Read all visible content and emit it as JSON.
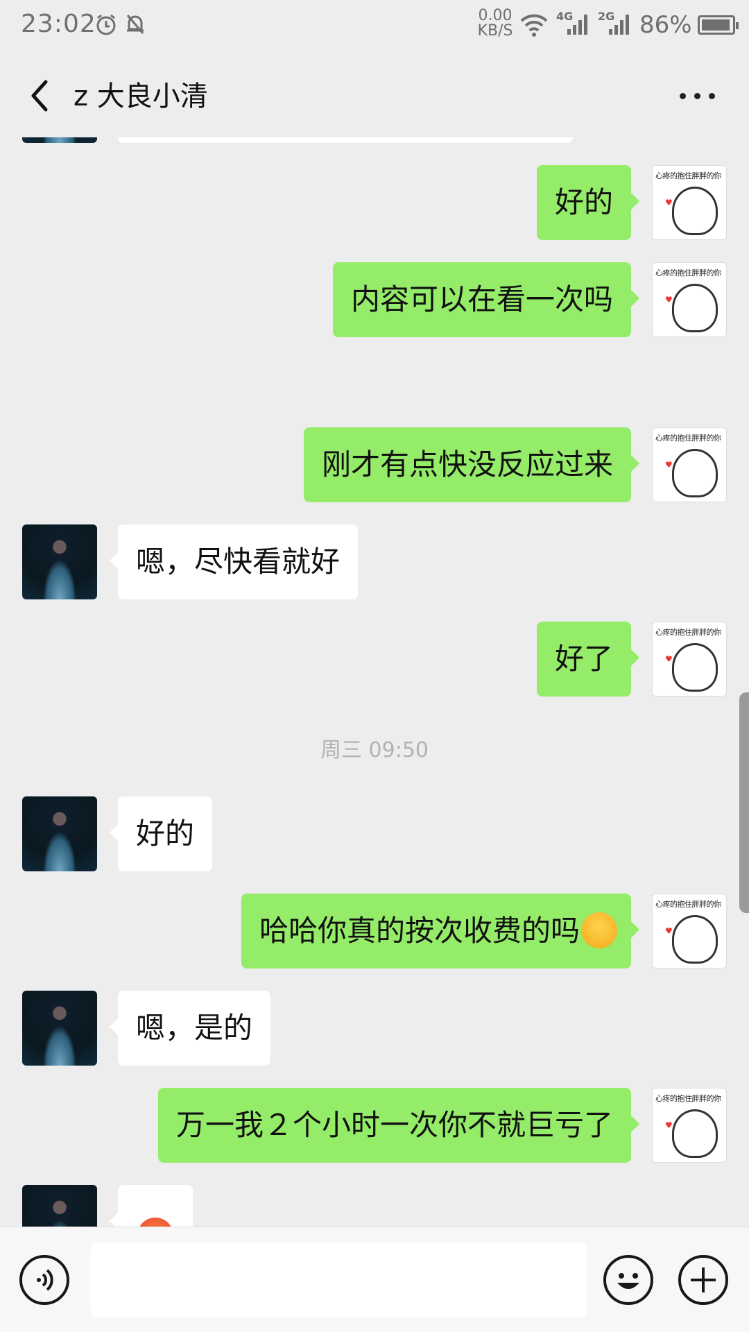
{
  "status": {
    "time": "23:02",
    "speed_top": "0.00",
    "speed_bottom": "KB/S",
    "net1": "4G",
    "net2": "2G",
    "battery": "86%"
  },
  "header": {
    "title": "z 大良小清"
  },
  "sticker_caption": "心疼的抱住胖胖的你",
  "messages": [
    {
      "side": "right",
      "text": "好的"
    },
    {
      "side": "right",
      "text": "内容可以在看一次吗"
    },
    {
      "side": "right",
      "text": "刚才有点快没反应过来"
    },
    {
      "side": "left",
      "text": "嗯，尽快看就好"
    },
    {
      "side": "right",
      "text": "好了"
    },
    {
      "side": "left",
      "text": "好的"
    },
    {
      "side": "right",
      "text": "哈哈你真的按次收费的吗"
    },
    {
      "side": "left",
      "text": "嗯，是的"
    },
    {
      "side": "right",
      "text": "万一我２个小时一次你不就巨亏了"
    }
  ],
  "timestamp": "周三 09:50",
  "icons": {
    "back": "back-arrow-icon",
    "more": "more-dots-icon",
    "voice": "voice-icon",
    "emoji": "emoji-icon",
    "plus": "plus-icon"
  }
}
